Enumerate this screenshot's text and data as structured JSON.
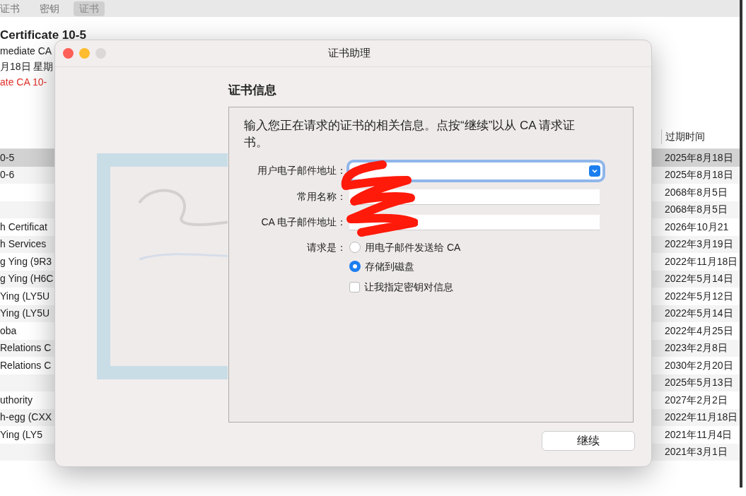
{
  "background_window": {
    "tabs": [
      {
        "label": "证书",
        "selected": false
      },
      {
        "label": "密钥",
        "selected": false
      },
      {
        "label": "证书",
        "selected": true
      }
    ],
    "detail": {
      "title": "Certificate 10-5",
      "subtitle": "mediate CA",
      "date": "月18日 星期",
      "warning": "ate CA 10-"
    },
    "table": {
      "columns": [
        "过期时间"
      ],
      "rows": [
        {
          "name": "0-5",
          "expires": "2025年8月18日",
          "selected": true
        },
        {
          "name": "0-6",
          "expires": "2025年8月18日",
          "selected": false
        },
        {
          "name": "",
          "expires": "2068年8月5日",
          "selected": false
        },
        {
          "name": "",
          "expires": "2068年8月5日",
          "selected": false
        },
        {
          "name": "h Certificat",
          "expires": "2026年10月21",
          "selected": false
        },
        {
          "name": "h Services",
          "expires": "2022年3月19日",
          "selected": false
        },
        {
          "name": "g Ying (9R3",
          "expires": "2022年11月18日",
          "selected": false
        },
        {
          "name": "g Ying (H6C",
          "expires": "2022年5月14日",
          "selected": false
        },
        {
          "name": "Ying (LY5U",
          "expires": "2022年5月12日",
          "selected": false
        },
        {
          "name": "Ying (LY5U",
          "expires": "2022年5月14日",
          "selected": false
        },
        {
          "name": "oba",
          "expires": "2022年4月25日",
          "selected": false
        },
        {
          "name": "Relations C",
          "expires": "2023年2月8日",
          "selected": false
        },
        {
          "name": "Relations C",
          "expires": "2030年2月20日",
          "selected": false
        },
        {
          "name": "",
          "expires": "2025年5月13日",
          "selected": false
        },
        {
          "name": "uthority",
          "expires": "2027年2月2日",
          "selected": false
        },
        {
          "name": "h-egg (CXX",
          "expires": "2022年11月18日",
          "selected": false
        },
        {
          "name": "Ying (LY5",
          "expires": "2021年11月4日",
          "selected": false
        },
        {
          "name": "",
          "expires": "2021年3月1日",
          "selected": false
        }
      ]
    }
  },
  "dialog": {
    "title": "证书助理",
    "section_title": "证书信息",
    "description": "输入您正在请求的证书的相关信息。点按“继续”以从 CA 请求证书。",
    "fields": [
      {
        "label": "用户电子邮件地址：",
        "kind": "dropdown",
        "focused": true
      },
      {
        "label": "常用名称：",
        "kind": "text",
        "focused": false
      },
      {
        "label": "CA 电子邮件地址：",
        "kind": "text",
        "focused": false
      }
    ],
    "request_label": "请求是：",
    "options": [
      {
        "label": "用电子邮件发送给 CA",
        "selected": false
      },
      {
        "label": "存储到磁盘",
        "selected": true
      }
    ],
    "checkbox": {
      "label": "让我指定密钥对信息",
      "checked": false
    },
    "continue_button": "继续"
  }
}
